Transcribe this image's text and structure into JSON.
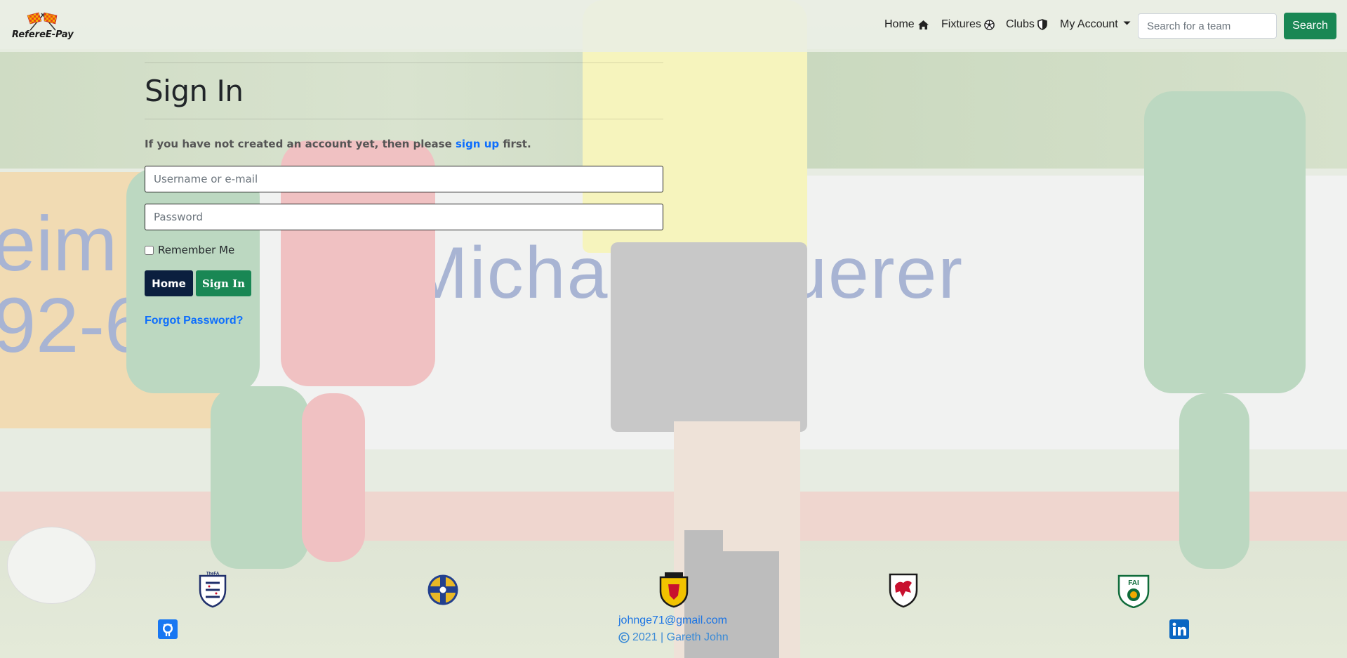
{
  "brand": {
    "name": "RefereE-Pay",
    "logo_icon": "checkered-flags-icon"
  },
  "nav": {
    "items": [
      {
        "label": "Home",
        "icon": "house-icon"
      },
      {
        "label": "Fixtures",
        "icon": "soccer-ball-icon"
      },
      {
        "label": "Clubs",
        "icon": "shield-icon"
      },
      {
        "label": "My Account",
        "icon": "caret-down-icon"
      }
    ],
    "search_placeholder": "Search for a team",
    "search_button": "Search"
  },
  "signin": {
    "title": "Sign In",
    "intro_prefix": "If you have not created an account yet, then please ",
    "intro_link": "sign up",
    "intro_suffix": " first.",
    "username_placeholder": "Username or e-mail",
    "password_placeholder": "Password",
    "remember_label": "Remember Me",
    "home_button": "Home",
    "signin_button": "Sign In",
    "forgot_link": "Forgot Password?"
  },
  "footer": {
    "crests": [
      {
        "name": "england-fa-crest",
        "text": "TheFA"
      },
      {
        "name": "northern-ireland-fa-crest"
      },
      {
        "name": "scotland-fa-crest"
      },
      {
        "name": "wales-fa-crest"
      },
      {
        "name": "ireland-fai-crest",
        "text": "FAI"
      }
    ],
    "email": "johnge71@gmail.com",
    "copyright": "2021 | Gareth John",
    "social": [
      "github-icon",
      "linkedin-icon"
    ]
  },
  "colors": {
    "primary_green": "#198754",
    "home_button": "#0b1f3f",
    "link_blue": "#0d6efd"
  }
}
